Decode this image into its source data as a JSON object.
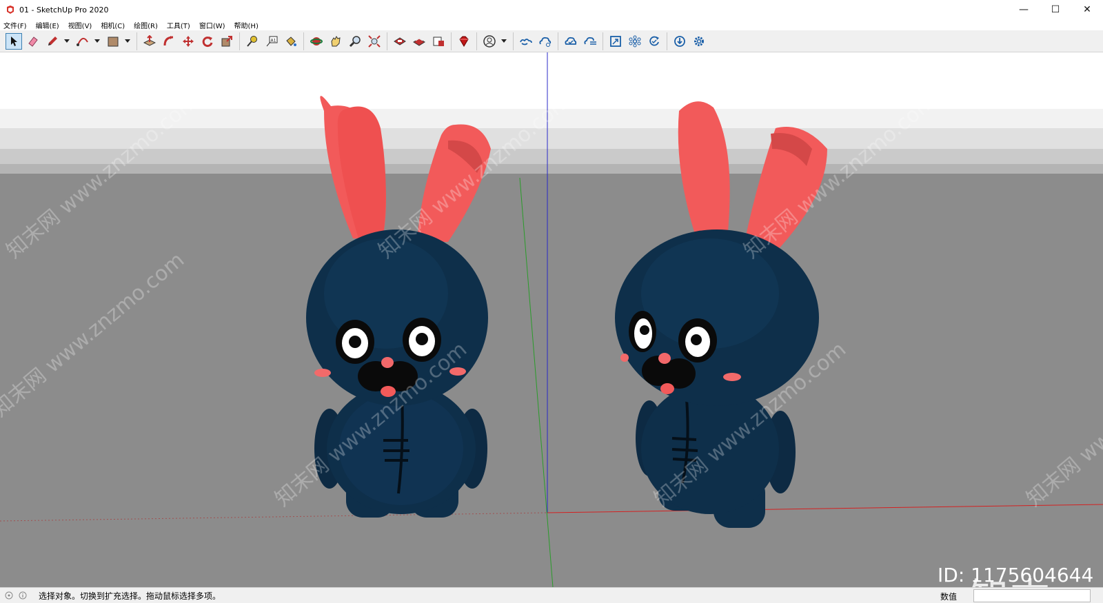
{
  "window": {
    "title": "01 - SketchUp Pro 2020",
    "minimize": "—",
    "maximize": "☐",
    "close": "✕"
  },
  "menu": [
    {
      "label": "文件(F)"
    },
    {
      "label": "编辑(E)"
    },
    {
      "label": "视图(V)"
    },
    {
      "label": "相机(C)"
    },
    {
      "label": "绘图(R)"
    },
    {
      "label": "工具(T)"
    },
    {
      "label": "窗口(W)"
    },
    {
      "label": "帮助(H)"
    }
  ],
  "toolbar": {
    "tools": [
      "select-icon",
      "eraser-icon",
      "pencil-icon",
      "arc-icon",
      "rectangle-icon",
      "push-pull-icon",
      "follow-me-icon",
      "move-icon",
      "rotate-icon",
      "scale-icon",
      "tape-measure-icon",
      "text-icon",
      "paint-bucket-icon",
      "orbit-icon",
      "pan-icon",
      "zoom-icon",
      "zoom-extents-icon",
      "warehouse-icon",
      "extension-warehouse-icon",
      "layout-icon",
      "ruby-icon",
      "profile-icon",
      "cloud-sync-icon",
      "cloud-share-icon",
      "cloud-check-icon",
      "cloud-list-icon",
      "scene-icon",
      "components-icon",
      "refresh-icon",
      "download-icon",
      "settings-icon"
    ]
  },
  "viewport": {
    "sky_color": "#ffffff",
    "ground_color": "#8c8c8c",
    "axis_colors": {
      "red": "#d42020",
      "green": "#2a9c2a",
      "blue": "#2828c8"
    },
    "model_colors": {
      "body": "#0e2f4a",
      "ears": "#f25a5a",
      "nose": "#f2686a",
      "eyes": "#ffffff",
      "mouth": "#0a0a0a"
    },
    "watermark_text": "知末网 www.znzmo.com"
  },
  "status": {
    "message": "选择对象。切换到扩充选择。拖动鼠标选择多项。",
    "vcb_label": "数值",
    "vcb_value": ""
  },
  "watermark": {
    "logo": "知末",
    "id": "ID: 1175604644"
  }
}
